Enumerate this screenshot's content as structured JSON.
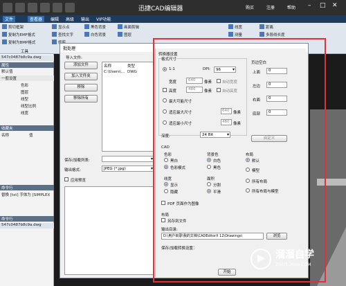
{
  "titlebar": {
    "title": "迅捷CAD编辑器",
    "buy": "购买",
    "register": "注册",
    "help": "帮助"
  },
  "menu": [
    "文件",
    "查看器",
    "编辑",
    "高级",
    "输出",
    "VIP功能"
  ],
  "ribbon": {
    "buttons": [
      "剪切框架",
      "复制为EMF格式",
      "复制为BMP格式",
      "显示点",
      "查找文字",
      "修剪",
      "黑色背景",
      "白色背景",
      "图层",
      "画面剪辑",
      "线宽",
      "测量",
      "距离",
      "多段线长度"
    ],
    "group_label": "工具"
  },
  "left_panel": {
    "file_tab": "547c0487b8c9a.dwg",
    "props_title": "属性",
    "rows": [
      "默认值",
      "一般设置",
      "色彩",
      "图层",
      "线型",
      "线型比例",
      "线宽"
    ],
    "favorites_title": "收藏夹",
    "fav_cols": [
      "名称",
      "值"
    ],
    "cmd_title": "命令行",
    "cmd_text": "替换 [txt] 字体为 [SIMPLEX",
    "cmd_title2": "命令行",
    "bottom_file": "547c0487b8c9a.dwg"
  },
  "batch_dialog": {
    "title": "批处理",
    "import_label": "导入文件:",
    "add_file": "添加文件",
    "add_folder": "加入文件夹",
    "remove": "移除",
    "remove_all": "移除所有",
    "col_name": "名称",
    "col_type": "类型",
    "file_path": "C:\\Users\\...",
    "file_type": "DWG",
    "save_load_label": "保存/加载列表:",
    "output_format_label": "输出格式:",
    "output_format_value": "JPEG (*.jpg)",
    "apply_preview": "应用预览"
  },
  "settings": {
    "title": "转换器设置",
    "image_size": "格式尺寸",
    "ratio": "1:1",
    "dpi_label": "DPI:",
    "dpi_value": "96",
    "width_label": "宽度",
    "width_value": "640",
    "height_label": "高度",
    "height_value": "480",
    "pixel": "像素",
    "auto_width": "自动宽度",
    "auto_height": "自动高度",
    "max_size": "最大可能尺寸",
    "fit_max": "适应最大尺寸",
    "fit_min": "适应最小尺寸",
    "fit_max_value": "640",
    "fit_min_value": "480",
    "depth_label": "深度:",
    "depth_value": "24 Bit",
    "margins_title": "页边空白",
    "margin_top": "上面",
    "margin_left": "左边",
    "margin_right": "右面",
    "margin_bottom": "底部",
    "margin_value": "0",
    "custom": "自定义",
    "cad_title": "CAD",
    "color_title": "色彩",
    "bw": "黑白",
    "color_mode": "色彩模式",
    "bg_title": "背景色",
    "white": "白色",
    "black": "黑色",
    "layout_title": "布局",
    "default": "默认",
    "model": "模型",
    "all_layouts": "所有布局",
    "all_layouts_model": "所有布局与模型",
    "linewidth_title": "线宽",
    "show": "显示",
    "hide": "隐藏",
    "scale_title": "面积",
    "split": "分割",
    "smooth": "平滑",
    "pdf_page": "PDF 页面作为图像",
    "layout2_title": "布局",
    "separate_file": "另存到文件",
    "output_dir_label": "输出目录:",
    "output_dir": "D:\\用户目录\\我的文档\\CADEditorX 12\\Drawings\\",
    "browse": "浏览",
    "save_load_settings": "保存/加载转换设置：",
    "start": "开始"
  },
  "watermark": {
    "title": "溜溜自学",
    "url": "ZIXUE.3066.COM"
  }
}
